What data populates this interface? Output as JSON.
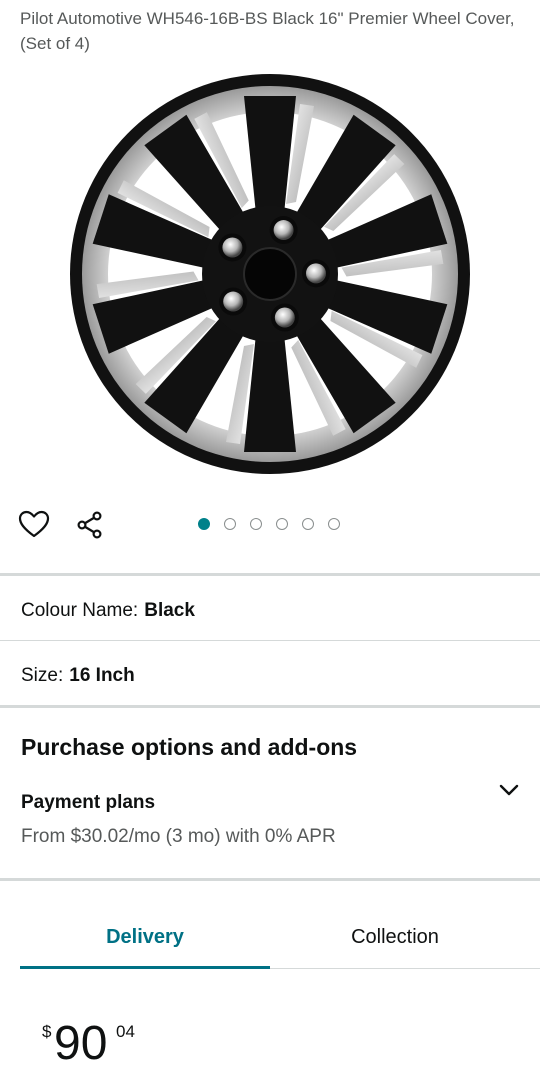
{
  "product": {
    "title": "Pilot Automotive WH546-16B-BS Black 16\" Premier Wheel Cover, (Set of 4)",
    "image_icon": "wheel-cover-image"
  },
  "gallery": {
    "wishlist_icon": "heart-icon",
    "share_icon": "share-icon",
    "image_count": 6,
    "active_index": 0
  },
  "attributes": {
    "colour": {
      "label": "Colour Name:",
      "value": "Black"
    },
    "size": {
      "label": "Size:",
      "value": "16 Inch"
    }
  },
  "purchase_options": {
    "heading": "Purchase options and add-ons",
    "payment_plans": {
      "title": "Payment plans",
      "description": "From $30.02/mo (3 mo) with 0% APR",
      "expand_icon": "chevron-down-icon"
    }
  },
  "tabs": [
    {
      "label": "Delivery",
      "active": true
    },
    {
      "label": "Collection",
      "active": false
    }
  ],
  "price": {
    "currency": "$",
    "whole": "90",
    "fraction": "04"
  },
  "colors": {
    "accent": "#007185",
    "dot_active": "#00818a",
    "divider": "#d5d9d9"
  }
}
